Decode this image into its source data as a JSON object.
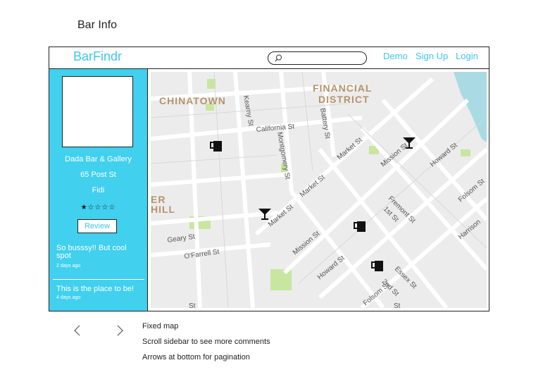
{
  "page_title": "Bar Info",
  "header": {
    "brand": "BarFindr",
    "search_placeholder": "",
    "nav": [
      "Demo",
      "Sign Up",
      "Login"
    ]
  },
  "sidebar": {
    "bar_name": "Dada Bar & Gallery",
    "address": "65 Post St",
    "neighborhood": "Fidi",
    "rating": "1 of 5",
    "stars": "★☆☆☆☆",
    "review_button": "Review",
    "comments": [
      {
        "text": "So busssy!! But cool spot",
        "time": "2 days ago"
      },
      {
        "text": "This is the place to be!",
        "time": "4 days ago"
      }
    ]
  },
  "map": {
    "district_labels": [
      "CHINATOWN",
      "FINANCIAL",
      "DISTRICT",
      "ER",
      "HILL"
    ],
    "street_labels": [
      "Kearny St",
      "California St",
      "Battery St",
      "Montgomery St",
      "Market St",
      "Mission St",
      "Howard St",
      "Folsom St",
      "Fremont St",
      "1st St",
      "Geary St",
      "O'Farrell St",
      "Harrison",
      "Essex St",
      "2nd St",
      "St",
      "St"
    ],
    "markers": [
      "cocktail-icon",
      "mug-icon"
    ]
  },
  "footer_notes": [
    "Fixed map",
    "Scroll sidebar to see more comments",
    "Arrows at bottom for pagination"
  ],
  "colors": {
    "accent": "#41d0ee",
    "link": "#3fc6ea",
    "water": "#aadbe4",
    "park": "#c8e6a0"
  }
}
